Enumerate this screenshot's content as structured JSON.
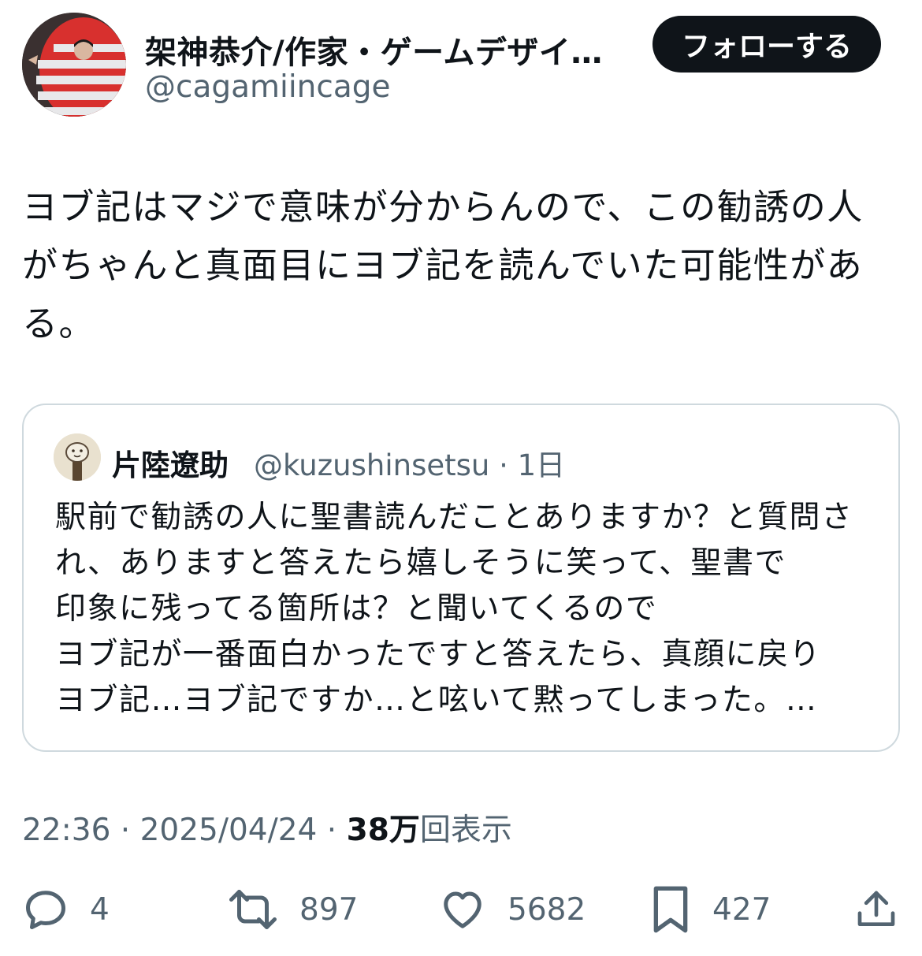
{
  "author": {
    "name": "架神恭介/作家・ゲームデザイ…",
    "handle": "@cagamiincage",
    "follow_label": "フォローする"
  },
  "tweet": {
    "text": "ヨブ記はマジで意味が分からんので、この勧誘の人がちゃんと真面目にヨブ記を読んでいた可能性がある。"
  },
  "quote": {
    "name": "片陸遼助",
    "handle_time": "@kuzushinsetsu · 1日",
    "text": "駅前で勧誘の人に聖書読んだことありますか？と質問され、ありますと答えたら嬉しそうに笑って、聖書で\n印象に残ってる箇所は？と聞いてくるので\nヨブ記が一番面白かったですと答えたら、真顔に戻り\nヨブ記…ヨブ記ですか…と呟いて黙ってしまった。…"
  },
  "meta": {
    "datetime": "22:36 · 2025/04/24 · ",
    "views_count": "38万",
    "views_label": "回表示"
  },
  "actions": {
    "replies": "4",
    "reposts": "897",
    "likes": "5682",
    "bookmarks": "427"
  },
  "icons": {
    "reply": "reply-icon",
    "repost": "repost-icon",
    "like": "heart-icon",
    "bookmark": "bookmark-icon",
    "share": "share-icon"
  }
}
